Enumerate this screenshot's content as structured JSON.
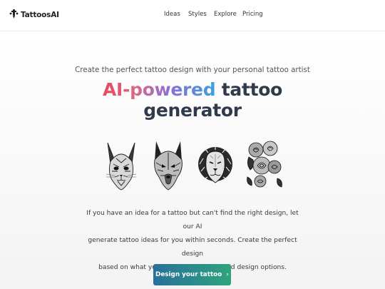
{
  "header": {
    "logo_text": "TattoosAI",
    "nav": [
      {
        "label": "Ideas"
      },
      {
        "label": "Styles"
      },
      {
        "label": "Explore"
      },
      {
        "label": "Pricing"
      }
    ]
  },
  "hero": {
    "subtitle": "Create the perfect tattoo design with your personal tattoo artist",
    "headline_highlight": "AI-powered",
    "headline_rest_line1": " tattoo",
    "headline_line2": "generator",
    "gallery": [
      {
        "name": "cat"
      },
      {
        "name": "wolf"
      },
      {
        "name": "lion"
      },
      {
        "name": "roses"
      }
    ],
    "description_lines": [
      "If you have an idea for a tattoo but can't find the right design, let our AI",
      "generate tattoo ideas for you within seconds. Create the perfect design",
      "based on what you like, and get unlimited design options."
    ],
    "cta_label": "Design your tattoo",
    "cta_icon": "chevron-right-icon"
  },
  "colors": {
    "headline": "#2f3a4a",
    "gradient_start": "#e6485f",
    "gradient_end": "#38a3d9",
    "cta_start": "#2a6f9a",
    "cta_end": "#2ea47d"
  }
}
